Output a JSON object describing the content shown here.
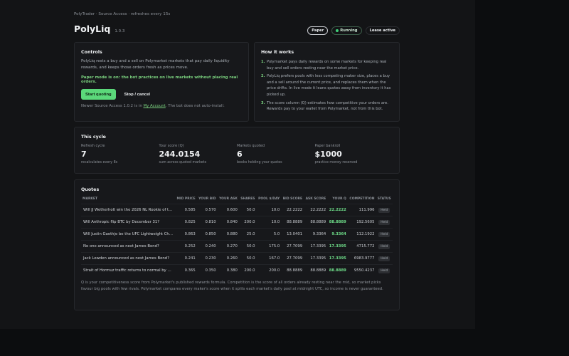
{
  "header": {
    "topline": "PolyTrader · Source Access · refreshes every 15s",
    "title": "PolyLiq",
    "version": "1.0.3",
    "pills": {
      "paper": "Paper",
      "running": "Running",
      "lease": "Lease active"
    }
  },
  "controls": {
    "title": "Controls",
    "description": "PolyLiq rests a buy and a sell on Polymarket markets that pay daily liquidity rewards, and keeps those orders fresh as prices move.",
    "paper_note": "Paper mode is on: the bot practices on live markets without placing real orders.",
    "start_label": "Start quoting",
    "stop_label": "Stop / cancel",
    "update_prefix": "Newer Source Access 1.0.2 is in ",
    "update_link": "My Account",
    "update_suffix": ". The bot does not auto-install."
  },
  "how": {
    "title": "How it works",
    "steps": [
      {
        "num": "1.",
        "text": "Polymarket pays daily rewards on some markets for keeping real buy and sell orders resting near the market price."
      },
      {
        "num": "2.",
        "text": "PolyLiq prefers pools with less competing maker size, places a buy and a sell around the current price, and replaces them when the price drifts. In live mode it leans quotes away from inventory it has picked up."
      },
      {
        "num": "3.",
        "text": "The score column (Q) estimates how competitive your orders are. Rewards pay to your wallet from Polymarket, not from this bot."
      }
    ]
  },
  "cycle": {
    "title": "This cycle",
    "stats": [
      {
        "label": "Refresh cycle",
        "value": "7",
        "sub": "recalculates every 8s"
      },
      {
        "label": "Your score (Q)",
        "value": "244.0154",
        "sub": "sum across quoted markets"
      },
      {
        "label": "Markets quoted",
        "value": "6",
        "sub": "books holding your quotes"
      },
      {
        "label": "Paper bankroll",
        "value": "$1000",
        "sub": "practice money reserved"
      }
    ]
  },
  "quotes": {
    "title": "Quotes",
    "headers": {
      "market": "MARKET",
      "mid": "MID PRICE",
      "bid": "YOUR BID",
      "ask": "YOUR ASK",
      "shares": "SHARES",
      "pool": "POOL $/DAY",
      "bid_score": "BID SCORE",
      "ask_score": "ASK SCORE",
      "q": "YOUR Q",
      "competition": "COMPETITION",
      "status": "STATUS"
    },
    "rows": [
      {
        "market": "Will JJ Wetherholt win the 2026 NL Rookie of the Year?",
        "mid": "0.585",
        "bid": "0.570",
        "ask": "0.600",
        "shares": "50.0",
        "pool": "10.0",
        "bid_score": "22.2222",
        "ask_score": "22.2222",
        "q": "22.2222",
        "competition": "111.996",
        "status": "Held"
      },
      {
        "market": "Will Anthropic flip BTC by December 31?",
        "mid": "0.825",
        "bid": "0.810",
        "ask": "0.840",
        "shares": "200.0",
        "pool": "10.0",
        "bid_score": "88.8889",
        "ask_score": "88.8889",
        "q": "88.8889",
        "competition": "192.5605",
        "status": "Held"
      },
      {
        "market": "Will Justin Gaethje be the UFC Lightweight Champion?",
        "mid": "0.863",
        "bid": "0.850",
        "ask": "0.880",
        "shares": "25.0",
        "pool": "5.0",
        "bid_score": "13.0401",
        "ask_score": "9.3364",
        "q": "9.3364",
        "competition": "112.1922",
        "status": "Held"
      },
      {
        "market": "No one announced as next James Bond?",
        "mid": "0.252",
        "bid": "0.240",
        "ask": "0.270",
        "shares": "50.0",
        "pool": "175.0",
        "bid_score": "27.7099",
        "ask_score": "17.3395",
        "q": "17.3395",
        "competition": "4715.772",
        "status": "Held"
      },
      {
        "market": "Jack Lowden announced as next James Bond?",
        "mid": "0.241",
        "bid": "0.230",
        "ask": "0.260",
        "shares": "50.0",
        "pool": "167.0",
        "bid_score": "27.7099",
        "ask_score": "17.3395",
        "q": "17.3395",
        "competition": "6983.9777",
        "status": "Held"
      },
      {
        "market": "Strait of Hormuz traffic returns to normal by December 31?",
        "mid": "0.365",
        "bid": "0.350",
        "ask": "0.380",
        "shares": "200.0",
        "pool": "200.0",
        "bid_score": "88.8889",
        "ask_score": "88.8889",
        "q": "88.8889",
        "competition": "9550.4237",
        "status": "Held"
      }
    ],
    "footnote": "Q is your competitiveness score from Polymarket's published rewards formula. Competition is the score of all orders already resting near the mid, so market picks favour big pools with few rivals. Polymarket compares every maker's score when it splits each market's daily pool at midnight UTC, so income is never guaranteed."
  }
}
